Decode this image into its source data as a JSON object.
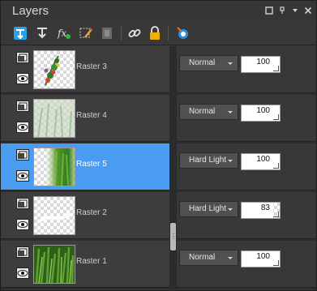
{
  "panel": {
    "title": "Layers"
  },
  "window_icons": [
    "restore-icon",
    "pin-icon",
    "menu-arrow-icon",
    "close-icon"
  ],
  "toolbar": [
    "new-raster-layer-icon",
    "new-vector-layer-icon",
    "fx-effects-icon",
    "edit-selection-icon",
    "mask-layer-icon",
    "link-layers-icon",
    "lock-layer-icon",
    "visibility-toggle-icon"
  ],
  "colors": {
    "selected_row": "#4a9cf3",
    "row_bg": "#3d3d3d",
    "panel_bg": "#383838"
  },
  "layers": [
    {
      "name": "Raster 3",
      "blend_mode": "Normal",
      "opacity": "100",
      "selected": false,
      "thumb": "floral-sprig"
    },
    {
      "name": "Raster 4",
      "blend_mode": "Normal",
      "opacity": "100",
      "selected": false,
      "thumb": "faint-green-grass"
    },
    {
      "name": "Raster 5",
      "blend_mode": "Hard Light",
      "opacity": "100",
      "selected": true,
      "thumb": "green-blur"
    },
    {
      "name": "Raster 2",
      "blend_mode": "Hard Light",
      "opacity": "83",
      "selected": false,
      "thumb": "white-wisp"
    },
    {
      "name": "Raster 1",
      "blend_mode": "Normal",
      "opacity": "100",
      "selected": false,
      "thumb": "grass-background"
    }
  ]
}
